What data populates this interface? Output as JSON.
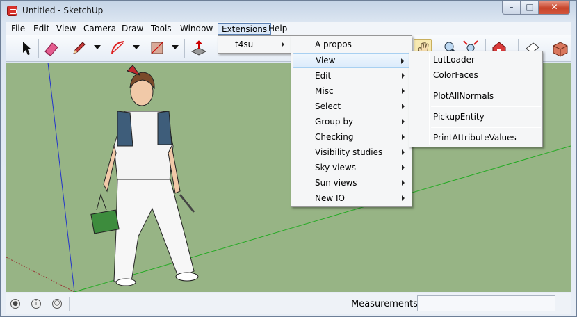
{
  "window": {
    "title": "Untitled - SketchUp"
  },
  "menubar": {
    "items": [
      "File",
      "Edit",
      "View",
      "Camera",
      "Draw",
      "Tools",
      "Window",
      "Extensions",
      "Help"
    ],
    "active": "Extensions"
  },
  "toolbar": {
    "icons": [
      "select-icon",
      "eraser-icon",
      "pencil-icon",
      "arc-icon",
      "rectangle-icon",
      "push-pull-icon",
      "pan-icon",
      "zoom-icon",
      "zoom-extents-icon",
      "warehouse-icon",
      "section-icon",
      "extension-warehouse-icon"
    ]
  },
  "extensions_menu": {
    "items": [
      {
        "label": "t4su",
        "has_submenu": true
      }
    ]
  },
  "t4su_menu": {
    "items": [
      {
        "label": "A propos",
        "has_submenu": false
      },
      {
        "label": "View",
        "has_submenu": true,
        "highlighted": true
      },
      {
        "label": "Edit",
        "has_submenu": true
      },
      {
        "label": "Misc",
        "has_submenu": true
      },
      {
        "label": "Select",
        "has_submenu": true
      },
      {
        "label": "Group by",
        "has_submenu": true
      },
      {
        "label": "Checking",
        "has_submenu": true
      },
      {
        "label": "Visibility studies",
        "has_submenu": true
      },
      {
        "label": "Sky views",
        "has_submenu": true
      },
      {
        "label": "Sun views",
        "has_submenu": true
      },
      {
        "label": "New IO",
        "has_submenu": true
      }
    ]
  },
  "view_menu": {
    "items": [
      {
        "label": "LutLoader"
      },
      {
        "label": "ColorFaces"
      },
      {
        "label": "PlotAllNormals"
      },
      {
        "label": "PickupEntity"
      },
      {
        "label": "PrintAttributeValues"
      }
    ]
  },
  "statusbar": {
    "measurements_label": "Measurements",
    "measurements_value": ""
  },
  "colors": {
    "ground": "#97b485",
    "sky": "#ffffff",
    "menu_highlight": "#dcebfb",
    "close_button": "#c7442a"
  }
}
